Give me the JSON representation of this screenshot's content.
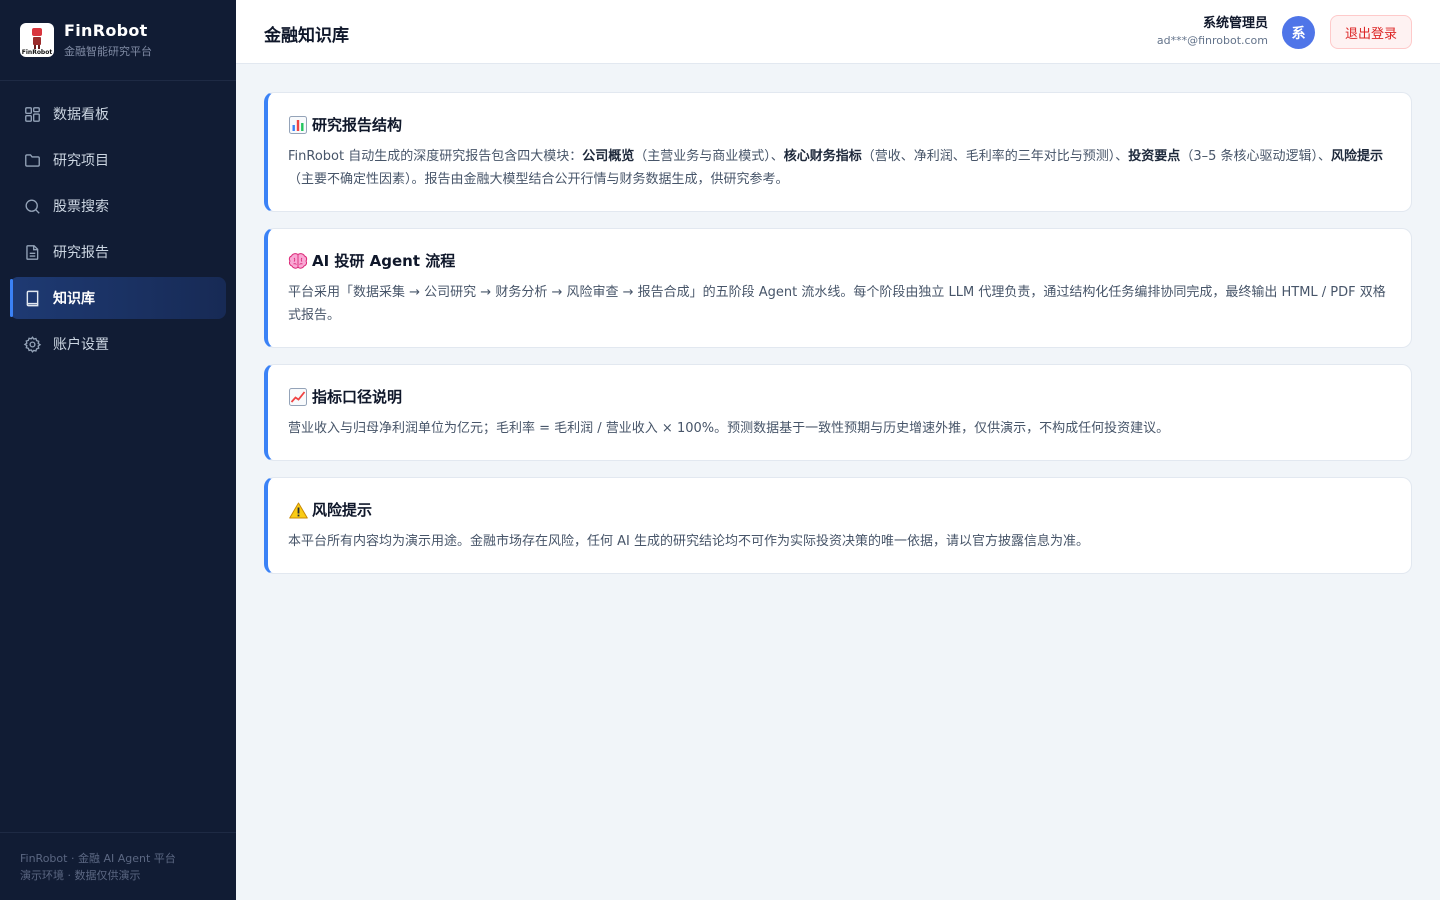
{
  "brand": {
    "title": "FinRobot",
    "subtitle": "金融智能研究平台",
    "logo_text": "FinRobot"
  },
  "sidebar": {
    "items": [
      {
        "label": "数据看板",
        "icon": "grid-icon",
        "active": false
      },
      {
        "label": "研究项目",
        "icon": "folder-icon",
        "active": false
      },
      {
        "label": "股票搜索",
        "icon": "search-icon",
        "active": false
      },
      {
        "label": "研究报告",
        "icon": "document-icon",
        "active": false
      },
      {
        "label": "知识库",
        "icon": "book-icon",
        "active": true
      },
      {
        "label": "账户设置",
        "icon": "gear-icon",
        "active": false
      }
    ],
    "footer_line1": "FinRobot · 金融 AI Agent 平台",
    "footer_line2": "演示环境 · 数据仅供演示"
  },
  "header": {
    "title": "金融知识库",
    "user_name": "系统管理员",
    "user_email": "ad***@finrobot.com",
    "avatar_letter": "系",
    "logout_label": "退出登录"
  },
  "cards": [
    {
      "icon": "bar-chart-icon",
      "title": "研究报告结构",
      "body": {
        "t1": "FinRobot 自动生成的深度研究报告包含四大模块：",
        "b1": "公司概览",
        "t2": "（主营业务与商业模式）、",
        "b2": "核心财务指标",
        "t3": "（营收、净利润、毛利率的三年对比与预测）、",
        "b3": "投资要点",
        "t4": "（3–5 条核心驱动逻辑）、",
        "b4": "风险提示",
        "t5": "（主要不确定性因素）。报告由金融大模型结合公开行情与财务数据生成，供研究参考。"
      }
    },
    {
      "icon": "brain-icon",
      "title": "AI 投研 Agent 流程",
      "body_text": "平台采用「数据采集 → 公司研究 → 财务分析 → 风险审查 → 报告合成」的五阶段 Agent 流水线。每个阶段由独立 LLM 代理负责，通过结构化任务编排协同完成，最终输出 HTML / PDF 双格式报告。"
    },
    {
      "icon": "trend-chart-icon",
      "title": "指标口径说明",
      "body_text": "营业收入与归母净利润单位为亿元；毛利率 = 毛利润 / 营业收入 × 100%。预测数据基于一致性预期与历史增速外推，仅供演示，不构成任何投资建议。"
    },
    {
      "icon": "warning-icon",
      "title": "风险提示",
      "body_text": "本平台所有内容均为演示用途。金融市场存在风险，任何 AI 生成的研究结论均不可作为实际投资决策的唯一依据，请以官方披露信息为准。"
    }
  ]
}
